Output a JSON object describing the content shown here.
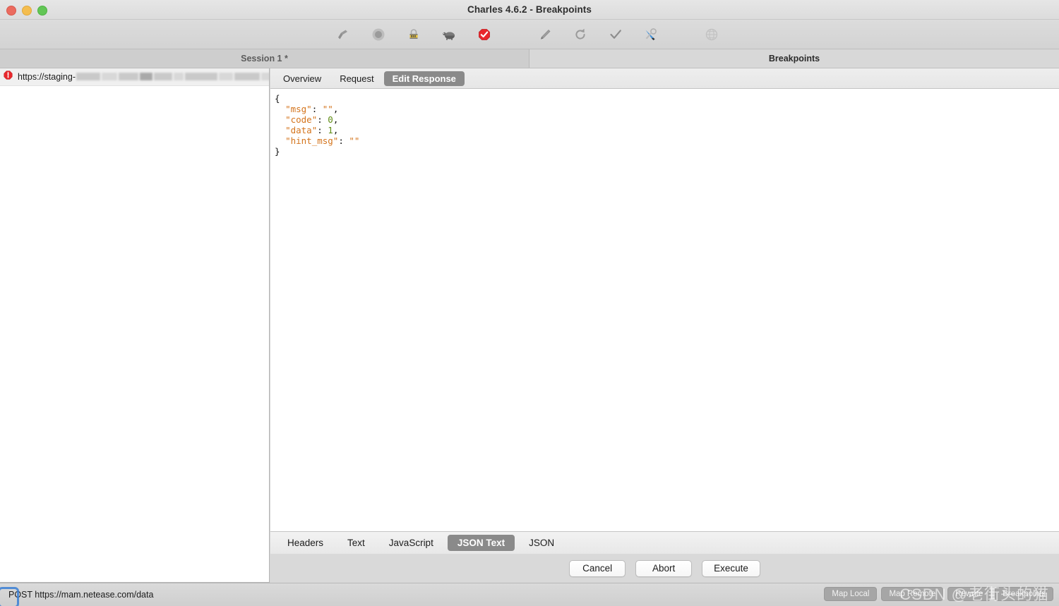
{
  "window": {
    "title": "Charles 4.6.2 - Breakpoints",
    "controls": [
      "close",
      "minimize",
      "maximize"
    ]
  },
  "toolbar": {
    "items": [
      {
        "name": "clear-session-icon",
        "label": "Clear Session"
      },
      {
        "name": "record-icon",
        "label": "Start Recording"
      },
      {
        "name": "ssl-proxying-icon",
        "label": "SSL Proxying Settings"
      },
      {
        "name": "throttle-icon",
        "label": "Throttle Settings"
      },
      {
        "name": "breakpoints-icon",
        "label": "Breakpoint Settings"
      },
      {
        "name": "compose-icon",
        "label": "Compose"
      },
      {
        "name": "repeat-icon",
        "label": "Repeat"
      },
      {
        "name": "validate-icon",
        "label": "Validate"
      },
      {
        "name": "tools-icon",
        "label": "Tools"
      },
      {
        "name": "dns-spoofing-icon",
        "label": "DNS Spoofing"
      }
    ]
  },
  "tabstrip": {
    "session_tab": "Session 1 *",
    "breakpoints_tab": "Breakpoints"
  },
  "sidebar": {
    "rows": [
      {
        "status_icon": "breakpoint-octagon-icon",
        "url_prefix": "https://staging-",
        "url_suffix": "-s"
      }
    ]
  },
  "detail": {
    "top_tabs": [
      {
        "label": "Overview",
        "selected": false
      },
      {
        "label": "Request",
        "selected": false
      },
      {
        "label": "Edit Response",
        "selected": true
      }
    ],
    "bottom_tabs": [
      {
        "label": "Headers",
        "selected": false
      },
      {
        "label": "Text",
        "selected": false
      },
      {
        "label": "JavaScript",
        "selected": false
      },
      {
        "label": "JSON Text",
        "selected": true
      },
      {
        "label": "JSON",
        "selected": false
      }
    ],
    "editor": {
      "language": "json",
      "lines": [
        [
          {
            "t": "{",
            "c": "pun"
          }
        ],
        [
          {
            "t": "  ",
            "c": "pun"
          },
          {
            "t": "\"msg\"",
            "c": "k"
          },
          {
            "t": ": ",
            "c": "pun"
          },
          {
            "t": "\"\"",
            "c": "str"
          },
          {
            "t": ",",
            "c": "pun"
          }
        ],
        [
          {
            "t": "  ",
            "c": "pun"
          },
          {
            "t": "\"code\"",
            "c": "k"
          },
          {
            "t": ": ",
            "c": "pun"
          },
          {
            "t": "0",
            "c": "num"
          },
          {
            "t": ",",
            "c": "pun"
          }
        ],
        [
          {
            "t": "  ",
            "c": "pun"
          },
          {
            "t": "\"data\"",
            "c": "k"
          },
          {
            "t": ": ",
            "c": "pun"
          },
          {
            "t": "1",
            "c": "num"
          },
          {
            "t": ",",
            "c": "pun"
          }
        ],
        [
          {
            "t": "  ",
            "c": "pun"
          },
          {
            "t": "\"hint_msg\"",
            "c": "k"
          },
          {
            "t": ": ",
            "c": "pun"
          },
          {
            "t": "\"\"",
            "c": "str"
          }
        ],
        [
          {
            "t": "}",
            "c": "pun"
          }
        ]
      ],
      "raw": "{\n  \"msg\": \"\",\n  \"code\": 0,\n  \"data\": 1,\n  \"hint_msg\": \"\"\n}"
    },
    "buttons": [
      {
        "label": "Cancel",
        "name": "cancel-button"
      },
      {
        "label": "Abort",
        "name": "abort-button"
      },
      {
        "label": "Execute",
        "name": "execute-button"
      }
    ]
  },
  "statusbar": {
    "request_line": "POST https://mam.netease.com/data",
    "tool_buttons": [
      {
        "label": "Map Local",
        "name": "map-local-button"
      },
      {
        "label": "Map Remote",
        "name": "map-remote-button"
      },
      {
        "label": "Rewrite",
        "name": "rewrite-button"
      },
      {
        "label": "Breakpoints",
        "name": "breakpoints-button"
      }
    ]
  },
  "watermark": {
    "text": "CSDN @老街头的猫"
  },
  "colors": {
    "accent_blue": "#3a7fd5",
    "breakpoint_red": "#e8272c",
    "tab_selected": "#8a8a8a",
    "json_key": "#d4741c",
    "json_number": "#5f8c14",
    "window_chrome": "#dcdcdc"
  }
}
